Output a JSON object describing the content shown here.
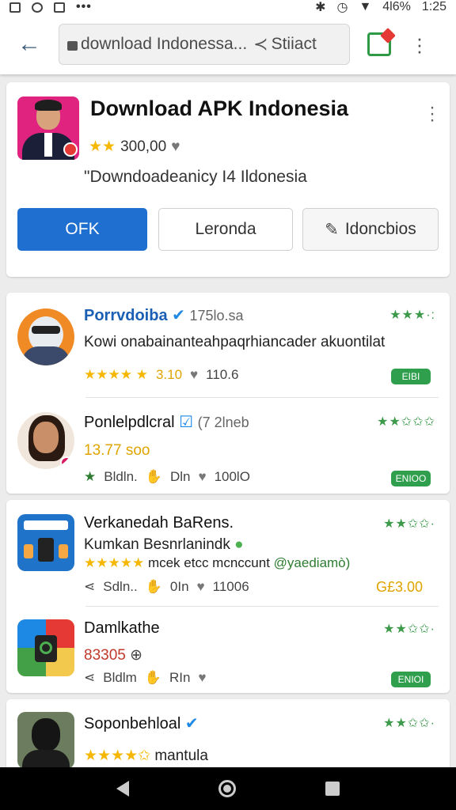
{
  "status": {
    "time": "1:25",
    "battery": "4l6%"
  },
  "browser": {
    "url_text": "download Indonessa...",
    "stop_label": "Stiiact"
  },
  "hero": {
    "title": "Download APK Indonesia",
    "rating_text": "300,00",
    "description": "\"Downdoadeanicy I4 Ildonesia",
    "btn_primary": "OFK",
    "btn_secondary": "Leronda",
    "btn_tertiary": "Idoncbios"
  },
  "items": [
    {
      "name": "Porrvdoiba",
      "meta": "175lo.sa",
      "line": "Kowi onabainanteahpaqrhiancader akuontilat",
      "stats": [
        "3.10",
        "110.6"
      ],
      "stars": "★★★·:",
      "pill": "EIBI"
    },
    {
      "name": "Ponlelpdlcral",
      "meta": "(7 2lneb",
      "line": "13.77 soo",
      "stats": [
        "Bldln.",
        "Dln",
        "100lO"
      ],
      "stars": "★★✩✩✩",
      "pill": "ENIOO"
    },
    {
      "name": "Verkanedah BaRens.",
      "line": "Kumkan Besnrlanindk",
      "line2": "mcek etcc mcnccunt",
      "line2_green": "@yaediamò)",
      "stats": [
        "Sdln..",
        "0In",
        "11006"
      ],
      "stars": "★★✩✩·",
      "price": "G£3.00"
    },
    {
      "name": "Damlkathe",
      "line": "83305",
      "stats": [
        "Bldlm",
        "RIn"
      ],
      "stars": "★★✩✩·",
      "pill": "ENIOI"
    },
    {
      "name": "Soponbehloal",
      "line": "mantula",
      "stars": "★★✩✩·"
    }
  ]
}
